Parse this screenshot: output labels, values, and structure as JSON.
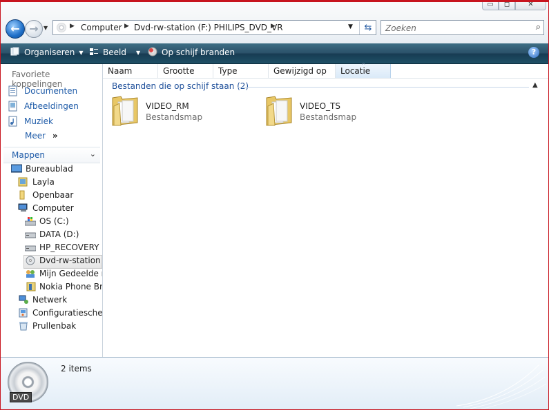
{
  "window": {
    "controls": {
      "minimize": "▭",
      "maximize": "◻",
      "close": "✕"
    }
  },
  "nav": {
    "address": [
      "Computer",
      "Dvd-rw-station (F:) PHILIPS_DVD_VR"
    ],
    "search_placeholder": "Zoeken"
  },
  "toolbar": {
    "organize": "Organiseren",
    "view": "Beeld",
    "burn": "Op schijf branden",
    "help": "?"
  },
  "sidebar": {
    "favorites_title": "Favoriete koppelingen",
    "favorites": [
      {
        "label": "Documenten",
        "icon": "documents-icon"
      },
      {
        "label": "Afbeeldingen",
        "icon": "pictures-icon"
      },
      {
        "label": "Muziek",
        "icon": "music-icon"
      },
      {
        "label": "Meer",
        "icon": "more-chevron-icon"
      }
    ],
    "more_glyph": "»",
    "folders_title": "Mappen",
    "tree": [
      {
        "label": "Bureaublad",
        "icon": "desktop-icon"
      },
      {
        "label": "Layla",
        "icon": "user-folder-icon"
      },
      {
        "label": "Openbaar",
        "icon": "public-folder-icon"
      },
      {
        "label": "Computer",
        "icon": "computer-icon"
      },
      {
        "label": "OS (C:)",
        "icon": "windows-drive-icon"
      },
      {
        "label": "DATA (D:)",
        "icon": "hard-drive-icon"
      },
      {
        "label": "HP_RECOVERY (E",
        "icon": "hard-drive-icon"
      },
      {
        "label": "Dvd-rw-station (",
        "icon": "dvd-drive-icon"
      },
      {
        "label": "Mijn Gedeelde m",
        "icon": "shared-folder-icon"
      },
      {
        "label": "Nokia Phone Bro",
        "icon": "phone-icon"
      },
      {
        "label": "Netwerk",
        "icon": "network-icon"
      },
      {
        "label": "Configuratiescherm",
        "icon": "control-panel-icon"
      },
      {
        "label": "Prullenbak",
        "icon": "recycle-bin-icon"
      }
    ]
  },
  "main": {
    "columns": [
      "Naam",
      "Grootte",
      "Type",
      "Gewijzigd op",
      "Locatie"
    ],
    "group_label": "Bestanden die op schijf staan (2)",
    "items": [
      {
        "name": "VIDEO_RM",
        "type": "Bestandsmap"
      },
      {
        "name": "VIDEO_TS",
        "type": "Bestandsmap"
      }
    ]
  },
  "details": {
    "count": "2 items",
    "drive_label": "DVD"
  },
  "colors": {
    "toolbar": "#1f4b62",
    "link": "#1e5ba8",
    "frame": "#c8141e"
  }
}
